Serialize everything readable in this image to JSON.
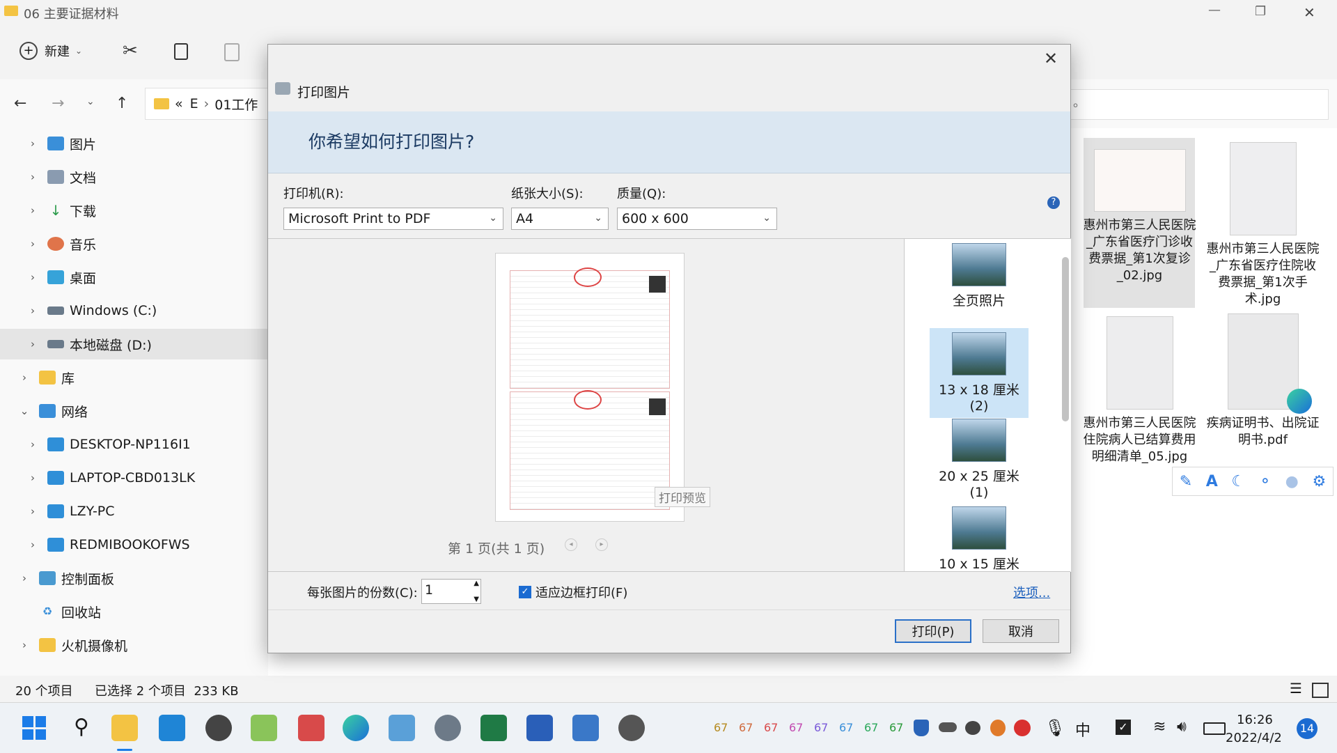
{
  "window": {
    "title": "06 主要证据材料",
    "minimize": "—",
    "restore": "❐",
    "close": "✕"
  },
  "toolbar": {
    "new_label": "新建"
  },
  "address": {
    "path_prefix": "«",
    "path_drive": "E",
    "path_sep": "›",
    "path_folder": "01工作",
    "search_placeholder": "。"
  },
  "nav": {
    "items": [
      {
        "label": "图片"
      },
      {
        "label": "文档"
      },
      {
        "label": "下载"
      },
      {
        "label": "音乐"
      },
      {
        "label": "桌面"
      },
      {
        "label": "Windows (C:)"
      },
      {
        "label": "本地磁盘 (D:)"
      },
      {
        "label": "库"
      },
      {
        "label": "网络"
      },
      {
        "label": "DESKTOP-NP116I1"
      },
      {
        "label": "LAPTOP-CBD013LK"
      },
      {
        "label": "LZY-PC"
      },
      {
        "label": "REDMIBOOKOFWS"
      },
      {
        "label": "控制面板"
      },
      {
        "label": "回收站"
      },
      {
        "label": "火机摄像机"
      }
    ]
  },
  "files": [
    {
      "name": "惠州市第三人民医院_广东省医疗门诊收费票据_第1次复诊_02.jpg"
    },
    {
      "name": "惠州市第三人民医院_广东省医疗住院收费票据_第1次手术.jpg"
    },
    {
      "name": "惠州市第三人民医院住院病人已结算费用明细清单_05.jpg"
    },
    {
      "name": "疾病证明书、出院证明书.pdf"
    }
  ],
  "status": {
    "count": "20 个项目",
    "selected": "已选择 2 个项目  233 KB"
  },
  "dialog": {
    "title": "打印图片",
    "close": "✕",
    "heading": "你希望如何打印图片?",
    "printer_label": "打印机(R):",
    "printer_value": "Microsoft Print to PDF",
    "paper_label": "纸张大小(S):",
    "paper_value": "A4",
    "quality_label": "质量(Q):",
    "quality_value": "600 x 600",
    "help": "?",
    "preview_tooltip": "打印预览",
    "page_indicator": "第 1 页(共 1 页)",
    "sizes": [
      {
        "label": "全页照片"
      },
      {
        "label": "13 x 18 厘米 (2)"
      },
      {
        "label": "20 x 25 厘米 (1)"
      },
      {
        "label": "10 x 15 厘米 (2)"
      }
    ],
    "copies_label": "每张图片的份数(C):",
    "copies_value": "1",
    "fit_label": "适应边框打印(F)",
    "fit_checked": true,
    "options_link": "选项...",
    "print_button": "打印(P)",
    "cancel_button": "取消"
  },
  "taskbar": {
    "time": "16:26",
    "date": "2022/4/2",
    "notif": "14",
    "ime": "中",
    "tray_numbers": [
      "67",
      "67",
      "67",
      "67",
      "67",
      "67",
      "67",
      "67"
    ],
    "tray_colors": [
      "#b58a1f",
      "#cf6a3d",
      "#d94a4a",
      "#c24ab0",
      "#7a5ad9",
      "#3a8fd9",
      "#2aa85a",
      "#2a9a3a"
    ]
  },
  "floating_toolbar": {
    "icons": [
      "edit-icon",
      "text-icon",
      "moon-icon",
      "share-icon",
      "person-icon",
      "settings-icon"
    ]
  }
}
